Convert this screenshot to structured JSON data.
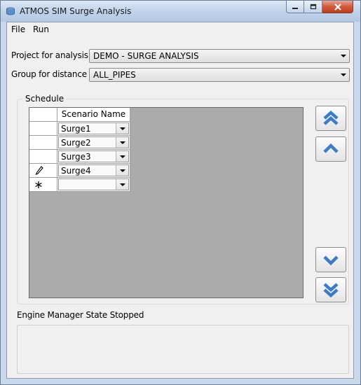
{
  "window": {
    "title": "ATMOS SIM Surge Analysis",
    "accent_color": "#3b7cc4"
  },
  "menu": {
    "items": [
      "File",
      "Run"
    ]
  },
  "form": {
    "project_label": "Project for analysis",
    "project_value": "DEMO - SURGE ANALYSIS",
    "group_label": "Group for distance",
    "group_value": "ALL_PIPES"
  },
  "schedule": {
    "title": "Schedule",
    "column_header": "Scenario Name",
    "rows": [
      {
        "indicator": "",
        "value": "Surge1"
      },
      {
        "indicator": "",
        "value": "Surge2"
      },
      {
        "indicator": "",
        "value": "Surge3"
      },
      {
        "indicator": "pencil-icon",
        "value": "Surge4"
      },
      {
        "indicator": "new-row-icon",
        "value": ""
      }
    ]
  },
  "nav_buttons": {
    "icons": [
      "double-chevron-up-icon",
      "chevron-up-icon",
      "chevron-down-icon",
      "double-chevron-down-icon"
    ]
  },
  "status": {
    "text": "Engine Manager State Stopped"
  }
}
